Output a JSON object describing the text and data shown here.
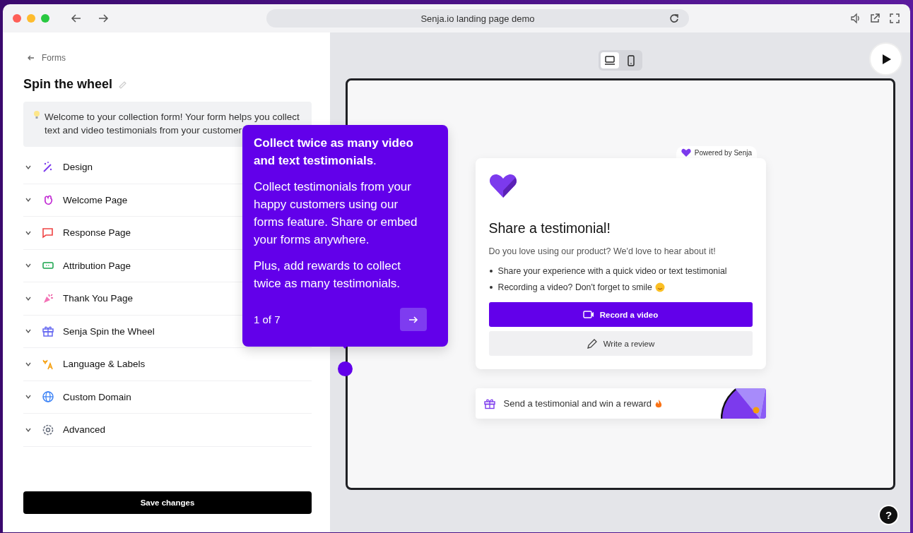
{
  "browser": {
    "url": "Senja.io landing page demo"
  },
  "sidebar": {
    "back_link": "Forms",
    "title": "Spin the wheel",
    "info": "Welcome to your collection form! Your form helps you collect text and video testimonials from your customer",
    "items": [
      {
        "label": "Design",
        "expanded": false
      },
      {
        "label": "Welcome Page",
        "expanded": false
      },
      {
        "label": "Response Page",
        "expanded": false
      },
      {
        "label": "Attribution Page",
        "expanded": false
      },
      {
        "label": "Thank You Page",
        "expanded": false
      },
      {
        "label": "Senja Spin the Wheel",
        "expanded": false
      },
      {
        "label": "Language & Labels",
        "expanded": false
      },
      {
        "label": "Custom Domain",
        "expanded": false
      },
      {
        "label": "Advanced",
        "expanded": false
      }
    ],
    "save_button": "Save changes"
  },
  "tour": {
    "heading": "**Collect twice as many video and text testimonials**.",
    "paragraphs": [
      "Collect testimonials from your happy customers using our forms feature. Share or embed your forms anywhere.",
      "Plus, add rewards to collect twice as many testimonials."
    ],
    "step": "1 of 7"
  },
  "preview": {
    "device_toggle": [
      {
        "selected": true
      },
      {
        "selected": false
      }
    ],
    "powered_by": "Powered by Senja",
    "card": {
      "title": "Share a testimonial!",
      "subtitle": "Do you love using our product? We'd love to hear about it!",
      "bullets": [
        "Share your experience with a quick video or text testimonial",
        "Recording a video? Don't forget to smile"
      ],
      "record_button": "Record a video",
      "review_button": "Write a review"
    },
    "reward": "Send a testimonial and win a reward"
  },
  "help_button": "?"
}
